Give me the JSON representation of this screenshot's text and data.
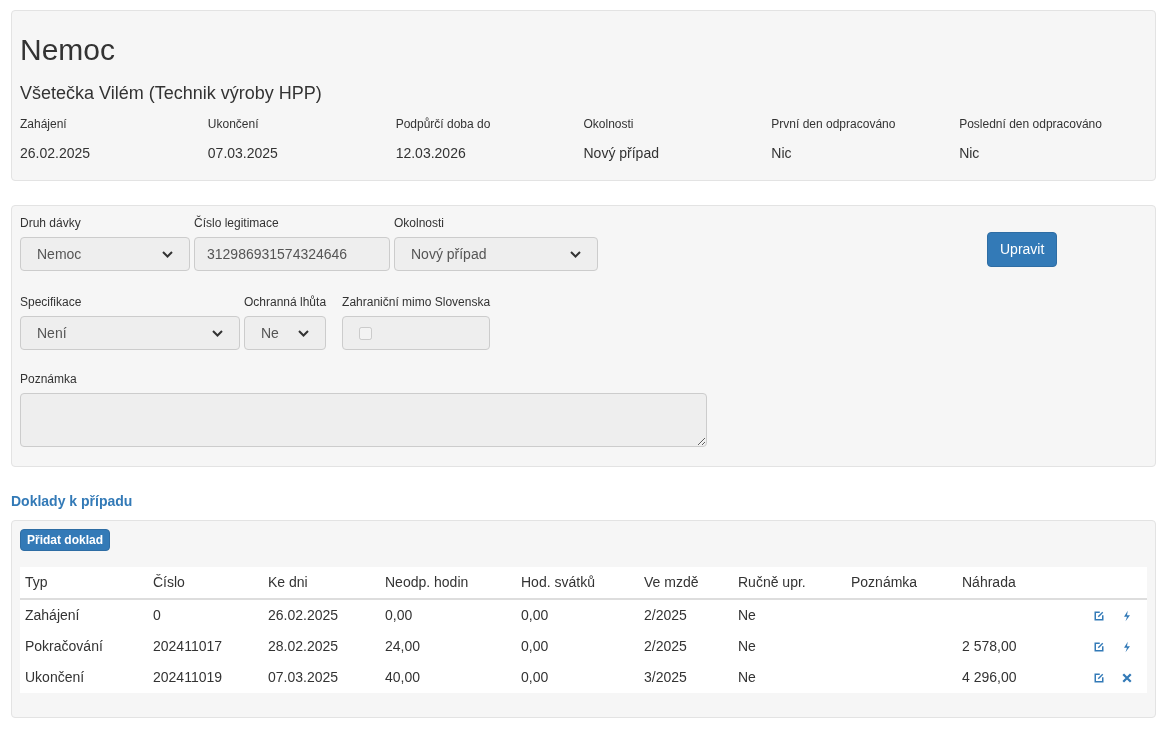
{
  "header": {
    "title": "Nemoc",
    "subtitle": "Všetečka Vilém (Technik výroby HPP)",
    "facts": [
      {
        "label": "Zahájení",
        "value": "26.02.2025"
      },
      {
        "label": "Ukončení",
        "value": "07.03.2025"
      },
      {
        "label": "Podpůrčí doba do",
        "value": "12.03.2026"
      },
      {
        "label": "Okolnosti",
        "value": "Nový případ"
      },
      {
        "label": "První den odpracováno",
        "value": "Nic"
      },
      {
        "label": "Poslední den odpracováno",
        "value": "Nic"
      }
    ]
  },
  "form": {
    "rows": [
      [
        {
          "kind": "select",
          "label": "Druh dávky",
          "value": "Nemoc",
          "disabled": true
        },
        {
          "kind": "input",
          "label": "Číslo legitimace",
          "value": "312986931574324646",
          "disabled": true
        },
        {
          "kind": "select",
          "label": "Okolnosti",
          "value": "Nový případ",
          "disabled": true
        }
      ],
      [
        {
          "kind": "select",
          "label": "Specifikace",
          "value": "Není",
          "disabled": true
        },
        {
          "kind": "select",
          "label": "Ochranná lhůta",
          "value": "Ne",
          "disabled": true
        },
        {
          "kind": "checkbox",
          "label": "Zahraniční mimo Slovenska",
          "checked": false,
          "disabled": true
        }
      ],
      [
        {
          "kind": "textarea",
          "label": "Poznámka",
          "disabled": true
        }
      ]
    ],
    "edit_button": "Upravit"
  },
  "documents": {
    "heading": "Doklady k případu",
    "add_button": "Přidat doklad",
    "columns": [
      "Typ",
      "Číslo",
      "Ke dni",
      "Neodp. hodin",
      "Hod. svátků",
      "Ve mzdě",
      "Ručně upr.",
      "Poznámka",
      "Náhrada"
    ],
    "rows": [
      {
        "cells": [
          "Zahájení",
          "0",
          "26.02.2025",
          "0,00",
          "0,00",
          "2/2025",
          "Ne",
          "",
          ""
        ],
        "actions": [
          {
            "kind": "edit"
          },
          {
            "kind": "bolt"
          }
        ]
      },
      {
        "cells": [
          "Pokračování",
          "202411017",
          "28.02.2025",
          "24,00",
          "0,00",
          "2/2025",
          "Ne",
          "",
          "2 578,00"
        ],
        "actions": [
          {
            "kind": "edit"
          },
          {
            "kind": "bolt"
          }
        ]
      },
      {
        "cells": [
          "Ukončení",
          "202411019",
          "07.03.2025",
          "40,00",
          "0,00",
          "3/2025",
          "Ne",
          "",
          "4 296,00"
        ],
        "actions": [
          {
            "kind": "edit"
          },
          {
            "kind": "remove"
          }
        ]
      }
    ]
  }
}
